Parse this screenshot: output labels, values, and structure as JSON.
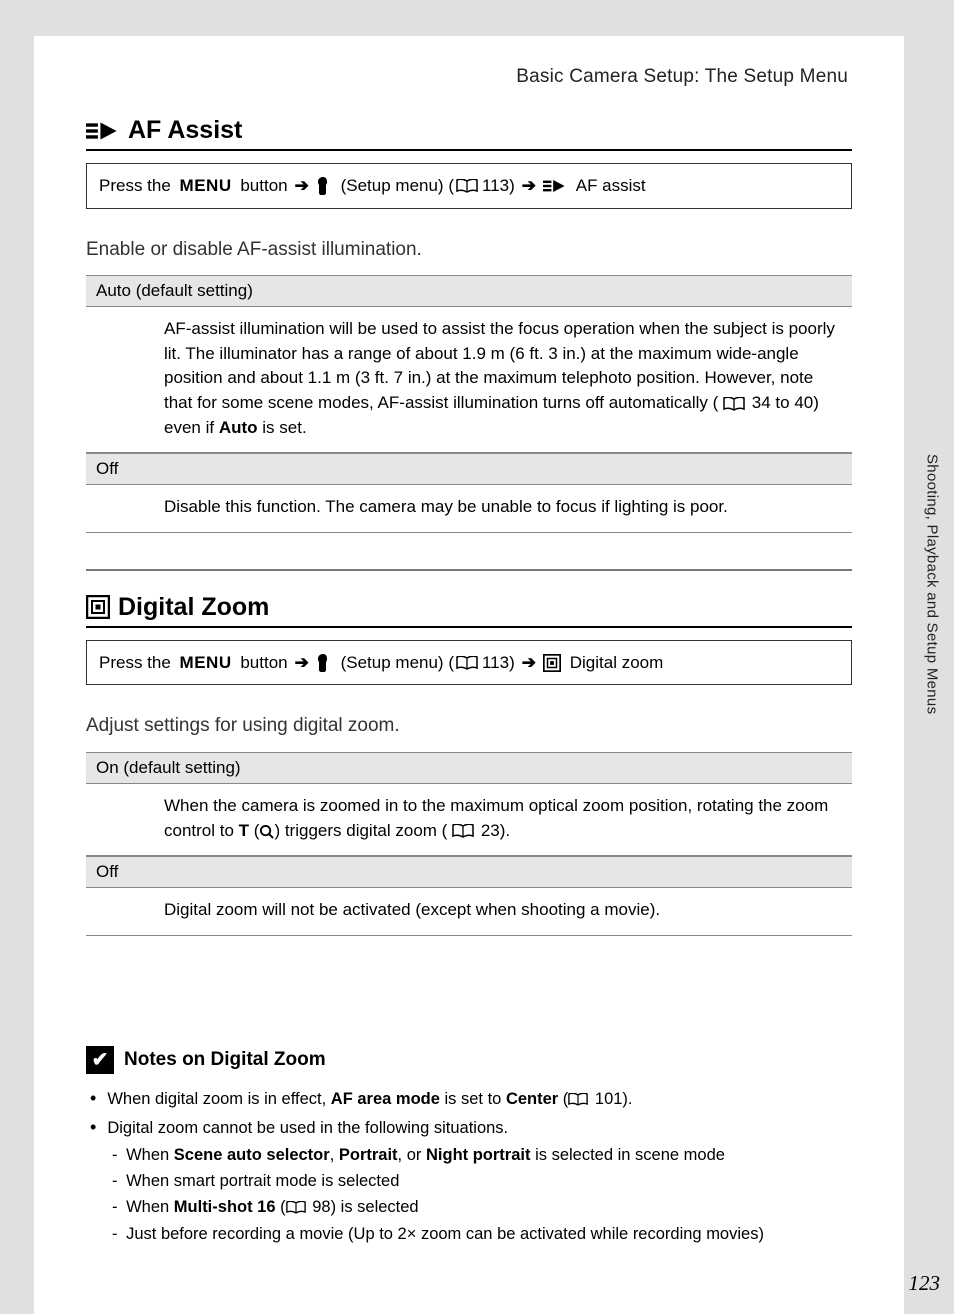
{
  "header": {
    "chapter_title": "Basic Camera Setup: The Setup Menu"
  },
  "side_tab_label": "Shooting, Playback and Setup Menus",
  "page_number": "123",
  "section1": {
    "title": "AF Assist",
    "crumb": {
      "pre": "Press the",
      "menu": "MENU",
      "btn": "button",
      "setup": "(Setup menu) (",
      "ref": "113)",
      "tail": "AF assist"
    },
    "intro": "Enable or disable AF-assist illumination.",
    "opt1": {
      "label": "Auto (default setting)",
      "body_a": "AF-assist illumination will be used to assist the focus operation when the subject is poorly lit. The illuminator has a range of about 1.9 m (6 ft. 3 in.) at the maximum wide-angle position and about 1.1 m (3 ft. 7 in.) at the maximum telephoto position. However, note that for some scene modes, AF-assist illumination turns off automatically (",
      "body_ref": "34 to 40) even if ",
      "body_bold": "Auto",
      "body_b": " is set."
    },
    "opt2": {
      "label": "Off",
      "body": "Disable this function. The camera may be unable to focus if lighting is poor."
    }
  },
  "section2": {
    "title": "Digital Zoom",
    "crumb": {
      "pre": "Press the",
      "menu": "MENU",
      "btn": "button",
      "setup": "(Setup menu) (",
      "ref": "113)",
      "tail": "Digital zoom"
    },
    "intro": "Adjust settings for using digital zoom.",
    "opt1": {
      "label": "On (default setting)",
      "body_a": "When the camera is zoomed in to the maximum optical zoom position, rotating the zoom control to ",
      "body_t": "T",
      "body_b": " (",
      "body_c": ") triggers digital zoom (",
      "body_ref": "23)."
    },
    "opt2": {
      "label": "Off",
      "body": "Digital zoom will not be activated (except when shooting a movie)."
    }
  },
  "notes": {
    "title": "Notes on Digital Zoom",
    "b1_a": "When digital zoom is in effect, ",
    "b1_bold1": "AF area mode",
    "b1_b": " is set to ",
    "b1_bold2": "Center",
    "b1_c": " (",
    "b1_ref": "101).",
    "b2": "Digital zoom cannot be used in the following situations.",
    "s1_a": "When ",
    "s1_b1": "Scene auto selector",
    "s1_b": ", ",
    "s1_b2": "Portrait",
    "s1_c": ", or ",
    "s1_b3": "Night portrait",
    "s1_d": " is selected in scene mode",
    "s2": "When smart portrait mode is selected",
    "s3_a": "When ",
    "s3_b": "Multi-shot 16",
    "s3_c": " (",
    "s3_ref": "98) is selected",
    "s4": "Just before recording a movie (Up to 2× zoom can be activated while recording movies)"
  }
}
